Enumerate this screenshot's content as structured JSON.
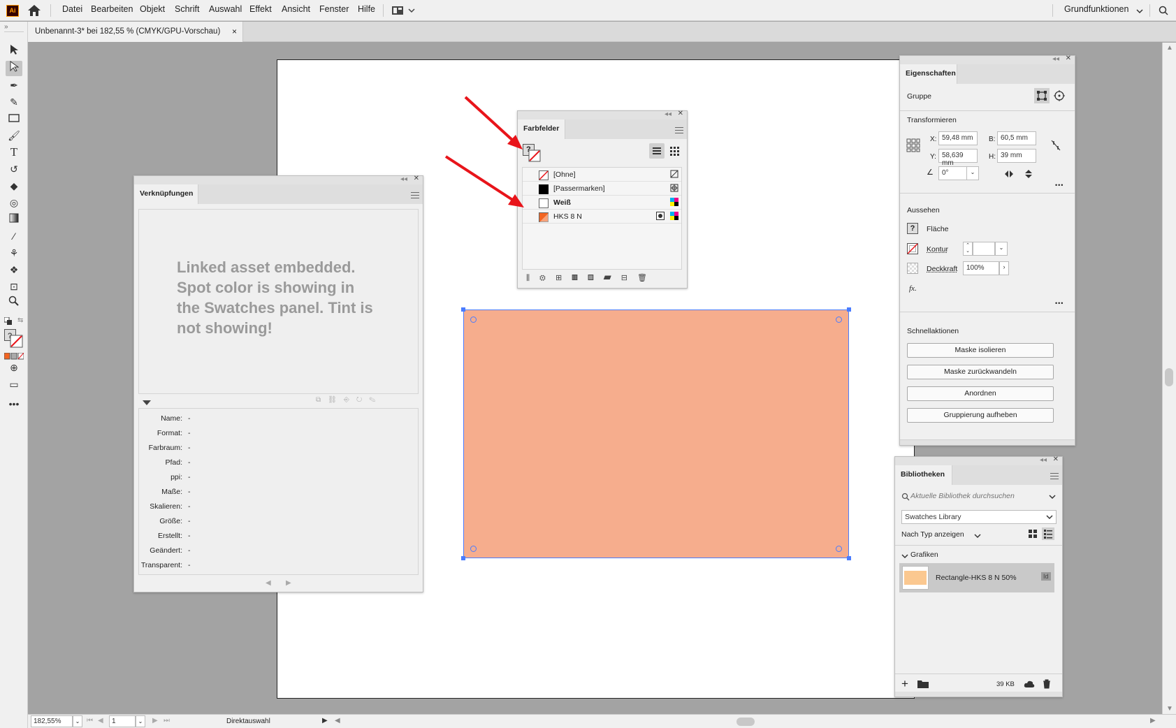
{
  "app": {
    "logo": "Ai",
    "workspace": "Grundfunktionen"
  },
  "menu": [
    "Datei",
    "Bearbeiten",
    "Objekt",
    "Schrift",
    "Auswahl",
    "Effekt",
    "Ansicht",
    "Fenster",
    "Hilfe"
  ],
  "document": {
    "tab_title": "Unbenannt-3* bei 182,55 % (CMYK/GPU-Vorschau)",
    "close": "×"
  },
  "links_panel": {
    "title": "Verknüpfungen",
    "annotation": "Linked asset embedded. Spot color is showing in the Swatches panel. Tint is not showing!",
    "fields": [
      {
        "label": "Name:",
        "value": "-"
      },
      {
        "label": "Format:",
        "value": "-"
      },
      {
        "label": "Farbraum:",
        "value": "-"
      },
      {
        "label": "Pfad:",
        "value": "-"
      },
      {
        "label": "ppi:",
        "value": "-"
      },
      {
        "label": "Maße:",
        "value": "-"
      },
      {
        "label": "Skalieren:",
        "value": "-"
      },
      {
        "label": "Größe:",
        "value": "-"
      },
      {
        "label": "Erstellt:",
        "value": "-"
      },
      {
        "label": "Geändert:",
        "value": "-"
      },
      {
        "label": "Transparent:",
        "value": "-"
      }
    ]
  },
  "swatches_panel": {
    "title": "Farbfelder",
    "fill_indicator": "?",
    "swatches": [
      {
        "name": "[Ohne]",
        "color": "none"
      },
      {
        "name": "[Passermarken]",
        "color": "#000000"
      },
      {
        "name": "Weiß",
        "color": "#ffffff"
      },
      {
        "name": "HKS 8 N",
        "color": "#f26522"
      }
    ]
  },
  "properties_panel": {
    "title": "Eigenschaften",
    "selection": "Gruppe",
    "transform": {
      "heading": "Transformieren",
      "x_label": "X:",
      "x": "59,48 mm",
      "y_label": "Y:",
      "y": "58,639 mm",
      "w_label": "B:",
      "w": "60,5 mm",
      "h_label": "H:",
      "h": "39 mm",
      "angle": "0°"
    },
    "appearance": {
      "heading": "Aussehen",
      "fill": "Fläche",
      "fill_indicator": "?",
      "stroke": "Kontur",
      "opacity_label": "Deckkraft",
      "opacity": "100%",
      "fx": "fx."
    },
    "quick_actions": {
      "heading": "Schnellaktionen",
      "buttons": [
        "Maske isolieren",
        "Maske zurückwandeln",
        "Anordnen",
        "Gruppierung aufheben"
      ]
    },
    "more": "•••"
  },
  "libraries_panel": {
    "title": "Bibliotheken",
    "search_placeholder": "Aktuelle Bibliothek durchsuchen",
    "library": "Swatches Library",
    "view_by": "Nach Typ anzeigen",
    "section": "Grafiken",
    "item": {
      "name": "Rectangle-HKS 8 N 50%",
      "badge": "Id",
      "swatch_color": "#fbc890"
    },
    "size": "39 KB"
  },
  "status_bar": {
    "zoom": "182,55%",
    "page": "1",
    "tool": "Direktauswahl"
  },
  "colors": {
    "rect_fill": "#f6ad8d",
    "selection": "#4a7cff",
    "arrow": "#e8141a"
  }
}
